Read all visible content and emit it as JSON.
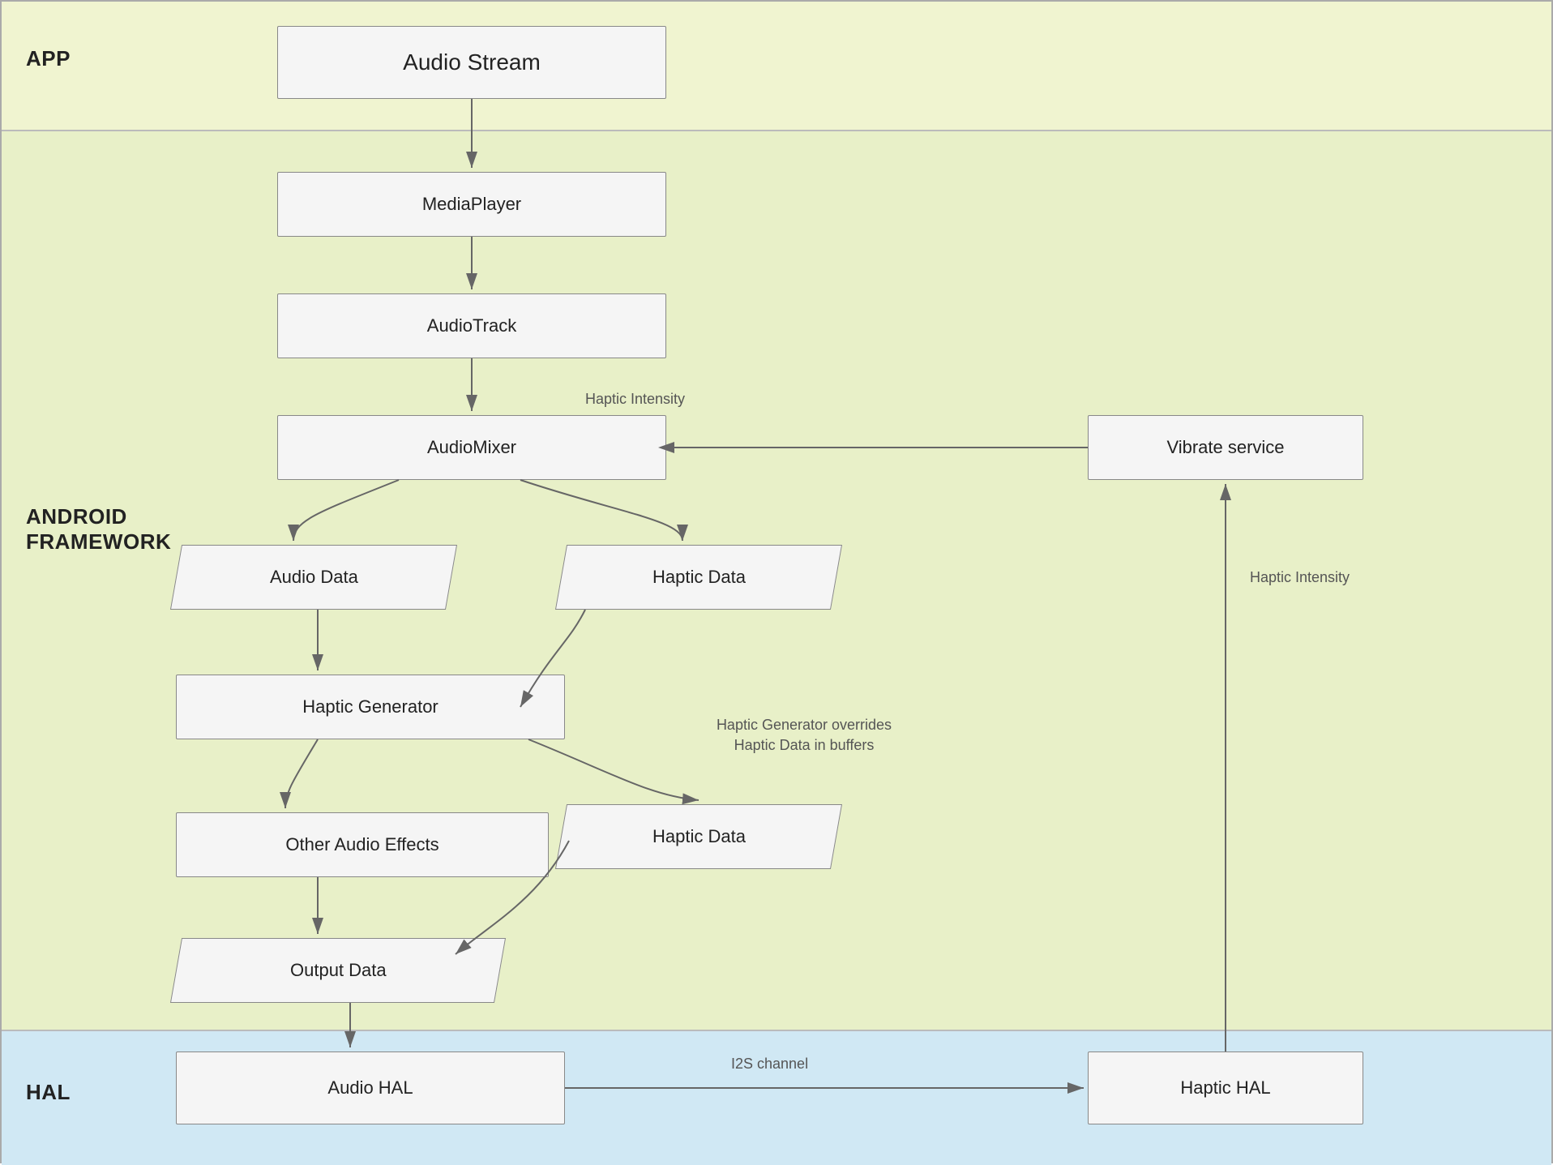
{
  "sections": {
    "app": {
      "label": "APP"
    },
    "framework": {
      "label_line1": "ANDROID",
      "label_line2": "FRAMEWORK"
    },
    "hal": {
      "label": "HAL"
    }
  },
  "boxes": {
    "audio_stream": "Audio Stream",
    "media_player": "MediaPlayer",
    "audio_track": "AudioTrack",
    "audio_mixer": "AudioMixer",
    "vibrate_service": "Vibrate service",
    "audio_data": "Audio Data",
    "haptic_data_1": "Haptic Data",
    "haptic_generator": "Haptic Generator",
    "haptic_data_2": "Haptic Data",
    "other_audio_effects": "Other Audio Effects",
    "output_data": "Output Data",
    "audio_hal": "Audio HAL",
    "haptic_hal": "Haptic HAL"
  },
  "labels": {
    "haptic_intensity_top": "Haptic Intensity",
    "haptic_intensity_right": "Haptic Intensity",
    "haptic_generator_overrides": "Haptic Generator overrides\nHaptic Data in buffers",
    "i2s_channel": "I2S channel"
  }
}
